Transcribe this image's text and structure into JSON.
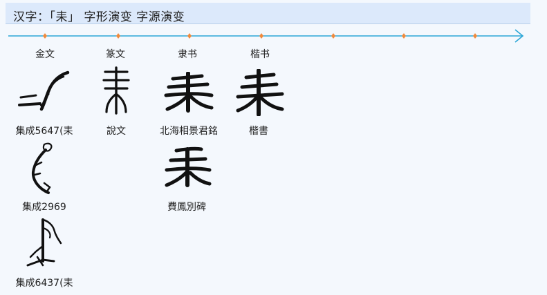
{
  "header": {
    "title": "汉字：「耒」 字形演变 字源演变"
  },
  "timeline": {
    "columns": [
      "金文",
      "篆文",
      "隶书",
      "楷书"
    ]
  },
  "glyphs": {
    "jinwen": [
      {
        "caption": "集成5647(耒",
        "icon": "bronze-script-glyph-1"
      },
      {
        "caption": "集成2969",
        "icon": "bronze-script-glyph-2"
      },
      {
        "caption": "集成6437(耒",
        "icon": "bronze-script-glyph-3"
      }
    ],
    "zhuanwen": [
      {
        "caption": "說文",
        "icon": "seal-script-glyph"
      }
    ],
    "lishu": [
      {
        "caption": "北海相景君銘",
        "icon": "clerical-script-glyph-1"
      },
      {
        "caption": "費鳳別碑",
        "icon": "clerical-script-glyph-2"
      }
    ],
    "kaishu": [
      {
        "caption": "楷書",
        "icon": "regular-script-glyph"
      }
    ]
  },
  "colors": {
    "title_background": "#dce9fb",
    "timeline_line": "#2aa6d6",
    "timeline_marker": "#f08a3c"
  }
}
